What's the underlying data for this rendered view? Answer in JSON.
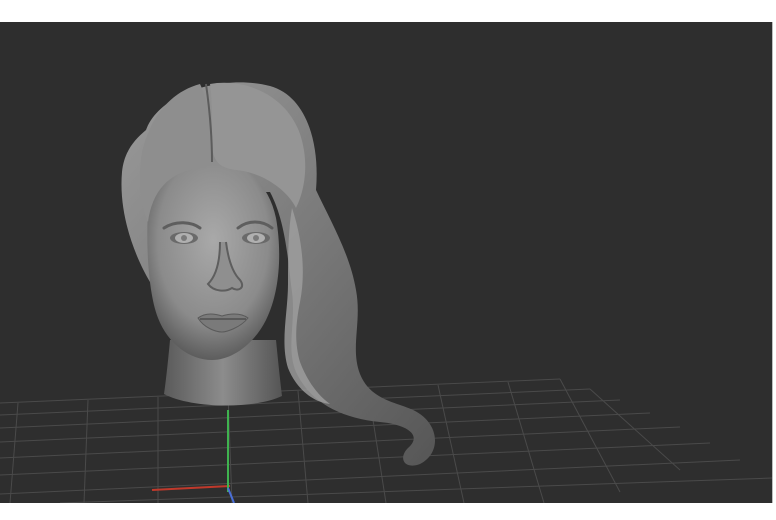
{
  "viewport": {
    "background_color": "#2e2e2e",
    "grid_color": "#4a4a4a",
    "axis_colors": {
      "x": "#c0392b",
      "y": "#3fb34f",
      "z": "#4a6fd8"
    },
    "model": {
      "name": "head-sculpt",
      "material_color": "#8a8a8a"
    }
  }
}
